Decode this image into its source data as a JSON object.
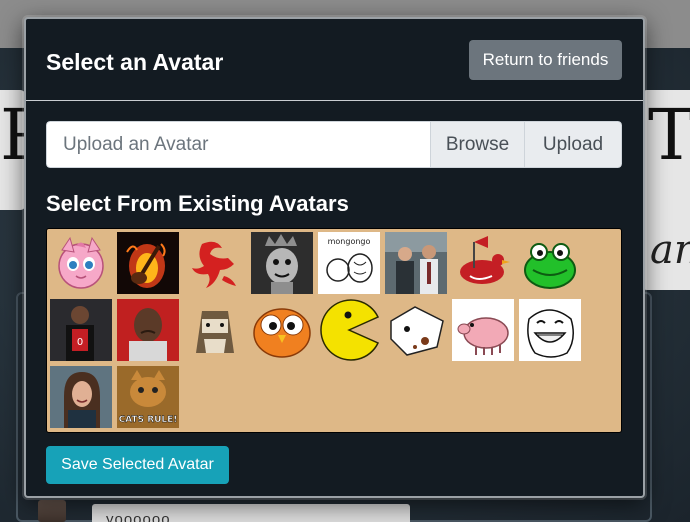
{
  "background": {
    "input_text": "yoooooo"
  },
  "modal": {
    "title": "Select an Avatar",
    "return_button": "Return to friends",
    "upload": {
      "placeholder": "Upload an Avatar",
      "browse_label": "Browse",
      "upload_label": "Upload"
    },
    "existing_title": "Select From Existing Avatars",
    "avatars": [
      {
        "icon": "pink-balloon-creature-icon"
      },
      {
        "icon": "flaming-guitar-icon"
      },
      {
        "icon": "red-dragon-ampersand-icon"
      },
      {
        "icon": "cartoon-girl-icon"
      },
      {
        "icon": "mongongo-sketch-icon",
        "caption": "mongongo"
      },
      {
        "icon": "office-men-photo-icon"
      },
      {
        "icon": "bird-with-flag-icon"
      },
      {
        "icon": "green-frog-icon"
      },
      {
        "icon": "basketball-player-photo-icon"
      },
      {
        "icon": "crying-man-photo-icon"
      },
      {
        "icon": "hamster-doll-icon"
      },
      {
        "icon": "orange-owl-icon"
      },
      {
        "icon": "pacman-icon"
      },
      {
        "icon": "spotted-dog-icon"
      },
      {
        "icon": "pink-pig-icon"
      },
      {
        "icon": "meme-face-icon"
      },
      {
        "icon": "smiling-woman-photo-icon"
      },
      {
        "icon": "cat-rule-photo-icon",
        "caption": "CATS RULE!"
      }
    ],
    "save_button": "Save Selected Avatar"
  },
  "colors": {
    "modal_bg": "#131b22",
    "grid_bg": "#deb887",
    "secondary_button": "#6c757d",
    "info_button": "#17a2b8"
  }
}
